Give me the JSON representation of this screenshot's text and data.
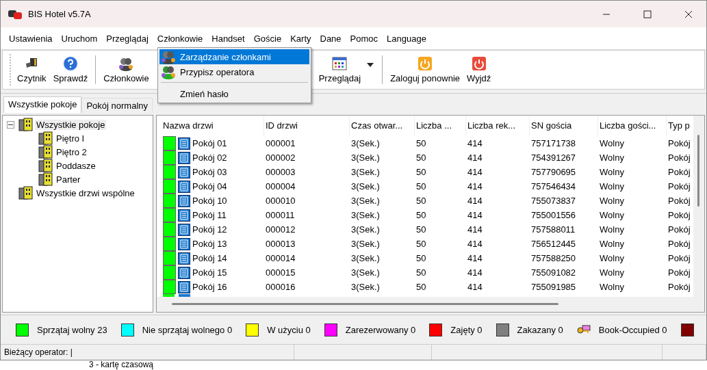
{
  "window": {
    "title": "BIS Hotel v5.7A"
  },
  "menu": [
    "Ustawienia",
    "Uruchom",
    "Przeglądaj",
    "Członkowie",
    "Handset",
    "Goście",
    "Karty",
    "Dane",
    "Pomoc",
    "Language"
  ],
  "toolbar": [
    {
      "kind": "button",
      "label": "Czytnik"
    },
    {
      "kind": "button",
      "label": "Sprawdź"
    },
    {
      "kind": "separator"
    },
    {
      "kind": "button",
      "label": "Członkowie"
    },
    {
      "kind": "gap"
    },
    {
      "kind": "button",
      "label": "Przeglądaj"
    },
    {
      "kind": "dropdown"
    },
    {
      "kind": "separator"
    },
    {
      "kind": "button",
      "label": "Zaloguj ponownie"
    },
    {
      "kind": "button",
      "label": "Wyjdź"
    }
  ],
  "dropdown": [
    {
      "kind": "item",
      "label": "Zarządzanie członkami",
      "selected": true
    },
    {
      "kind": "item",
      "label": "Przypisz operatora",
      "selected": false
    },
    {
      "kind": "separator"
    },
    {
      "kind": "item",
      "label": "Zmień hasło",
      "selected": false
    }
  ],
  "tabs": [
    {
      "label": "Wszystkie pokoje",
      "selected": true
    },
    {
      "label": "Pokój normalny",
      "selected": false
    }
  ],
  "tree": [
    {
      "label": "Wszystkie pokoje",
      "expanded": true,
      "selected": true,
      "children": [
        {
          "label": "Piętro I",
          "selected": false
        },
        {
          "label": "Piętro 2",
          "selected": false
        },
        {
          "label": "Poddasze",
          "selected": false
        },
        {
          "label": "Parter",
          "selected": false
        }
      ]
    },
    {
      "label": "Wszystkie drzwi wspólne",
      "selected": false
    }
  ],
  "table": {
    "columns": [
      "Nazwa drzwi",
      "ID drzwi",
      "Czas otwar...",
      "Liczba ...",
      "Liczba rek...",
      "SN gościa",
      "Liczba gości...",
      "Typ p"
    ],
    "rows": [
      {
        "color": "#00ff00",
        "cells": [
          "Pokój 01",
          "000001",
          "3(Sek.)",
          "50",
          "414",
          "757171738",
          "Wolny",
          "Pokój"
        ]
      },
      {
        "color": "#00ff00",
        "cells": [
          "Pokój 02",
          "000002",
          "3(Sek.)",
          "50",
          "414",
          "754391267",
          "Wolny",
          "Pokój"
        ]
      },
      {
        "color": "#00ff00",
        "cells": [
          "Pokój 03",
          "000003",
          "3(Sek.)",
          "50",
          "414",
          "757790695",
          "Wolny",
          "Pokój"
        ]
      },
      {
        "color": "#00ff00",
        "cells": [
          "Pokój 04",
          "000004",
          "3(Sek.)",
          "50",
          "414",
          "757546434",
          "Wolny",
          "Pokój"
        ]
      },
      {
        "color": "#00ff00",
        "cells": [
          "Pokój 10",
          "000010",
          "3(Sek.)",
          "50",
          "414",
          "755073837",
          "Wolny",
          "Pokój"
        ]
      },
      {
        "color": "#00ff00",
        "cells": [
          "Pokój 11",
          "000011",
          "3(Sek.)",
          "50",
          "414",
          "755001556",
          "Wolny",
          "Pokój"
        ]
      },
      {
        "color": "#00ff00",
        "cells": [
          "Pokój 12",
          "000012",
          "3(Sek.)",
          "50",
          "414",
          "757588011",
          "Wolny",
          "Pokój"
        ]
      },
      {
        "color": "#00ff00",
        "cells": [
          "Pokój 13",
          "000013",
          "3(Sek.)",
          "50",
          "414",
          "756512445",
          "Wolny",
          "Pokój"
        ]
      },
      {
        "color": "#00ff00",
        "cells": [
          "Pokój 14",
          "000014",
          "3(Sek.)",
          "50",
          "414",
          "757588250",
          "Wolny",
          "Pokój"
        ]
      },
      {
        "color": "#00ff00",
        "cells": [
          "Pokój 15",
          "000015",
          "3(Sek.)",
          "50",
          "414",
          "755091082",
          "Wolny",
          "Pokój"
        ]
      },
      {
        "color": "#00ff00",
        "cells": [
          "Pokój 16",
          "000016",
          "3(Sek.)",
          "50",
          "414",
          "755091985",
          "Wolny",
          "Pokój"
        ]
      }
    ]
  },
  "legend": [
    {
      "kind": "swatch",
      "color": "#00ff00",
      "label": "Sprzątaj wolny 23"
    },
    {
      "kind": "swatch",
      "color": "#00ffff",
      "label": "Nie sprzątaj wolnego 0"
    },
    {
      "kind": "swatch",
      "color": "#ffff00",
      "label": "W użyciu 0"
    },
    {
      "kind": "swatch",
      "color": "#ff00ff",
      "label": "Zarezerwowany 0"
    },
    {
      "kind": "swatch",
      "color": "#ff0000",
      "label": "Zajęty 0"
    },
    {
      "kind": "swatch",
      "color": "#808080",
      "label": "Zakazany 0"
    },
    {
      "kind": "key",
      "label": "Book-Occupied 0"
    },
    {
      "kind": "swatch",
      "color": "#800000"
    }
  ],
  "status_bar": {
    "label": "Bieżący operator:",
    "value": "|"
  },
  "background_text": "3 - kartę czasową"
}
